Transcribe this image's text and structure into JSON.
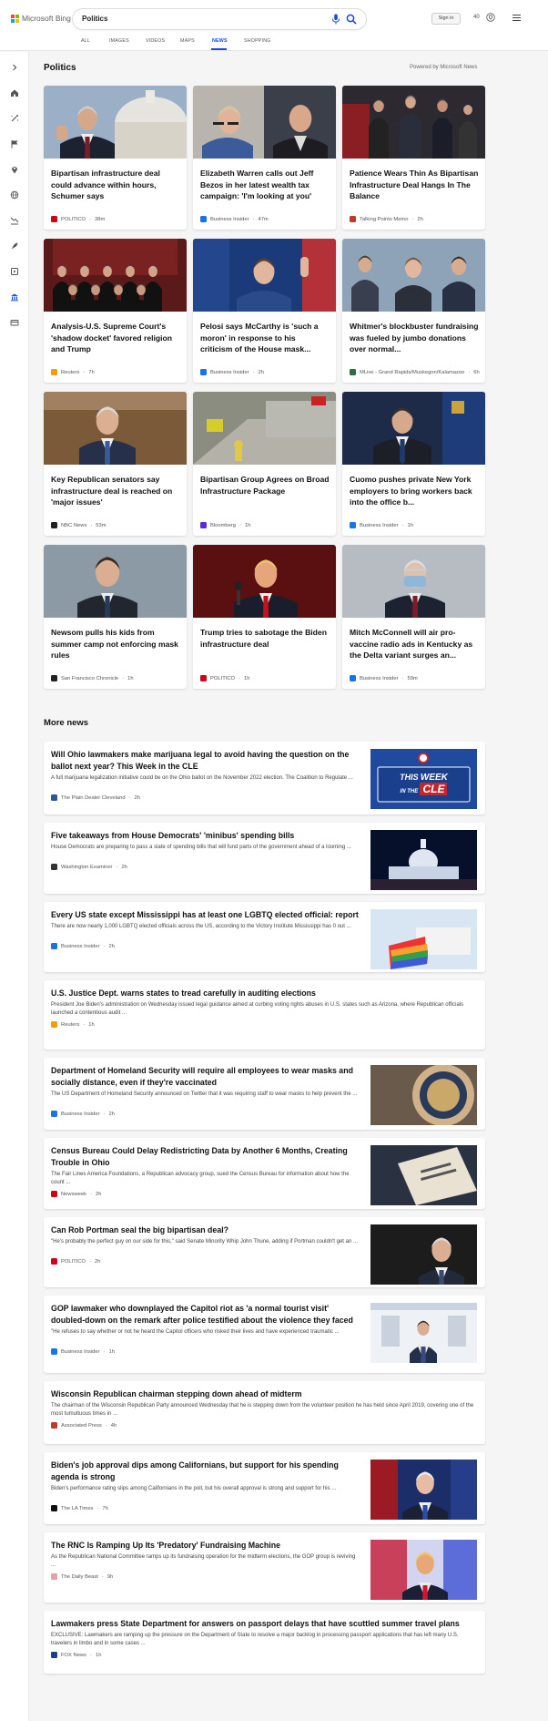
{
  "header": {
    "brand": "Microsoft Bing",
    "query": "Politics",
    "signin_label": "Sign in",
    "points": "40",
    "brand_colors": [
      "#f25022",
      "#7fba00",
      "#00a4ef",
      "#ffb900"
    ]
  },
  "tabs": [
    {
      "label": "ALL",
      "active": false
    },
    {
      "label": "IMAGES",
      "active": false
    },
    {
      "label": "VIDEOS",
      "active": false
    },
    {
      "label": "MAPS",
      "active": false
    },
    {
      "label": "NEWS",
      "active": true
    },
    {
      "label": "SHOPPING",
      "active": false
    }
  ],
  "sidebar": {
    "icons": [
      "chevron-right-icon",
      "home-icon",
      "magic-wand-icon",
      "flag-icon",
      "location-pin-icon",
      "globe-icon",
      "chart-icon",
      "rocket-icon",
      "film-icon",
      "bank-icon",
      "card-icon"
    ]
  },
  "section": {
    "title": "Politics",
    "powered_by": "Powered by Microsoft News"
  },
  "cards": [
    {
      "title": "Bipartisan infrastructure deal could advance within hours, Schumer says",
      "source": "POLITICO",
      "time": "38m",
      "src_color": "#d0021b",
      "img": "schumer"
    },
    {
      "title": "Elizabeth Warren calls out Jeff Bezos in her latest wealth tax campaign: 'I'm looking at you'",
      "source": "Business Insider",
      "time": "47m",
      "src_color": "#1a73e8",
      "img": "warren"
    },
    {
      "title": "Patience Wears Thin As Bipartisan Infrastructure Deal Hangs In The Balance",
      "source": "Talking Points Memo",
      "time": "2h",
      "src_color": "#c0392b",
      "img": "patience"
    },
    {
      "title": "Analysis-U.S. Supreme Court's 'shadow docket' favored religion and Trump",
      "source": "Reuters",
      "time": "7h",
      "src_color": "#f39c12",
      "img": "court"
    },
    {
      "title": "Pelosi says McCarthy is 'such a moron' in response to his criticism of the House mask...",
      "source": "Business Insider",
      "time": "2h",
      "src_color": "#1a73e8",
      "img": "pelosi"
    },
    {
      "title": "Whitmer's blockbuster fundraising was fueled by jumbo donations over normal...",
      "source": "MLive - Grand Rapids/Muskegon/Kalamazoo",
      "time": "6h",
      "src_color": "#2c6e3f",
      "img": "whitmer"
    },
    {
      "title": "Key Republican senators say infrastructure deal is reached on 'major issues'",
      "source": "NBC News",
      "time": "53m",
      "src_color": "#222222",
      "img": "portman"
    },
    {
      "title": "Bipartisan Group Agrees on Broad Infrastructure Package",
      "source": "Bloomberg",
      "time": "1h",
      "src_color": "#5b2bd6",
      "img": "construction"
    },
    {
      "title": "Cuomo pushes private New York employers to bring workers back into the office b...",
      "source": "Business Insider",
      "time": "1h",
      "src_color": "#1a73e8",
      "img": "cuomo"
    },
    {
      "title": "Newsom pulls his kids from summer camp not enforcing mask rules",
      "source": "San Francisco Chronicle",
      "time": "1h",
      "src_color": "#222222",
      "img": "newsom"
    },
    {
      "title": "Trump tries to sabotage the Biden infrastructure deal",
      "source": "POLITICO",
      "time": "1h",
      "src_color": "#d0021b",
      "img": "trump"
    },
    {
      "title": "Mitch McConnell will air pro-vaccine radio ads in Kentucky as the Delta variant surges an...",
      "source": "Business Insider",
      "time": "59m",
      "src_color": "#1a73e8",
      "img": "mcconnell"
    }
  ],
  "more": {
    "title": "More news",
    "items": [
      {
        "title": "Will Ohio lawmakers make marijuana legal to avoid having the question on the ballot next year? This Week in the CLE",
        "snippet": "A full marijuana legalization initiative could be on the Ohio ballot on the November 2022 election. The Coalition to Regulate ...",
        "source": "The Plain Dealer Cleveland",
        "time": "2h",
        "src_color": "#2b5797",
        "img": "cle",
        "img_text_1": "THIS",
        "img_text_2": "WEEK",
        "img_text_3": "IN THE",
        "img_text_4": "CLE"
      },
      {
        "title": "Five takeaways from House Democrats' 'minibus' spending bills",
        "snippet": "House Democrats are preparing to pass a slate of spending bills that will fund parts of the government ahead of a looming ...",
        "source": "Washington Examiner",
        "time": "2h",
        "src_color": "#333333",
        "img": "capitol"
      },
      {
        "title": "Every US state except Mississippi has at least one LGBTQ elected official: report",
        "snippet": "There are now nearly 1,000 LGBTQ elected officials across the US, according to the Victory Institute Mississippi has 0 out ...",
        "source": "Business Insider",
        "time": "2h",
        "src_color": "#1a73e8",
        "img": "pride"
      },
      {
        "title": "U.S. Justice Dept. warns states to tread carefully in auditing elections",
        "snippet": "President Joe Biden's administration on Wednesday issued legal guidance aimed at curbing voting rights abuses in U.S. states such as Arizona, where Republican officials launched a contentious audit ...",
        "source": "Reuters",
        "time": "1h",
        "src_color": "#f39c12",
        "img": ""
      },
      {
        "title": "Department of Homeland Security will require all employees to wear masks and socially distance, even if they're vaccinated",
        "snippet": "The US Department of Homeland Security announced on Twitter that it was requiring staff to wear masks to help prevent the ...",
        "source": "Business Insider",
        "time": "2h",
        "src_color": "#1a73e8",
        "img": "dhs"
      },
      {
        "title": "Census Bureau Could Delay Redistricting Data by Another 6 Months, Creating Trouble in Ohio",
        "snippet": "The Fair Lines America Foundations, a Republican advocacy group, sued the Census Bureau for information about how the count ...",
        "source": "Newsweek",
        "time": "2h",
        "src_color": "#d0021b",
        "img": "census"
      },
      {
        "title": "Can Rob Portman seal the big bipartisan deal?",
        "snippet": "\"He's probably the perfect guy on our side for this,\" said Senate Minority Whip John Thune, adding if Portman couldn't get an ...",
        "source": "POLITICO",
        "time": "2h",
        "src_color": "#d0021b",
        "img": "portman2"
      },
      {
        "title": "GOP lawmaker who downplayed the Capitol riot as 'a normal tourist visit' doubled-down on the remark after police testified about the violence they faced",
        "snippet": "\"He refuses to say whether or not he heard the Capitol officers who risked their lives and have experienced traumatic ...",
        "source": "Business Insider",
        "time": "1h",
        "src_color": "#1a73e8",
        "img": "gop"
      },
      {
        "title": "Wisconsin Republican chairman stepping down ahead of midterm",
        "snippet": "The chairman of the Wisconsin Republican Party announced Wednesday that he is stepping down from the volunteer position he has held since April 2019, covering one of the most tumultuous times in ...",
        "source": "Associated Press",
        "time": "4h",
        "src_color": "#c0392b",
        "img": ""
      },
      {
        "title": "Biden's job approval dips among Californians, but support for his spending agenda is strong",
        "snippet": "Biden's performance rating slips among Californians in the poll, but his overall approval is strong and support for his ...",
        "source": "The LA Times",
        "time": "7h",
        "src_color": "#111111",
        "img": "biden"
      },
      {
        "title": "The RNC Is Ramping Up Its 'Predatory' Fundraising Machine",
        "snippet": "As the Republican National Committee ramps up its fundraising operation for the midterm elections, the GOP group is reviving ...",
        "source": "The Daily Beast",
        "time": "9h",
        "src_color": "#e8a0a8",
        "img": "rnc"
      },
      {
        "title": "Lawmakers press State Department for answers on passport delays that have scuttled summer travel plans",
        "snippet": "EXCLUSIVE: Lawmakers are ramping up the pressure on the Department of State to resolve a major backlog in processing passport applications that has left many U.S. travelers in limbo and in some cases ...",
        "source": "FOX News",
        "time": "1h",
        "src_color": "#1c3f8a",
        "img": ""
      }
    ]
  }
}
